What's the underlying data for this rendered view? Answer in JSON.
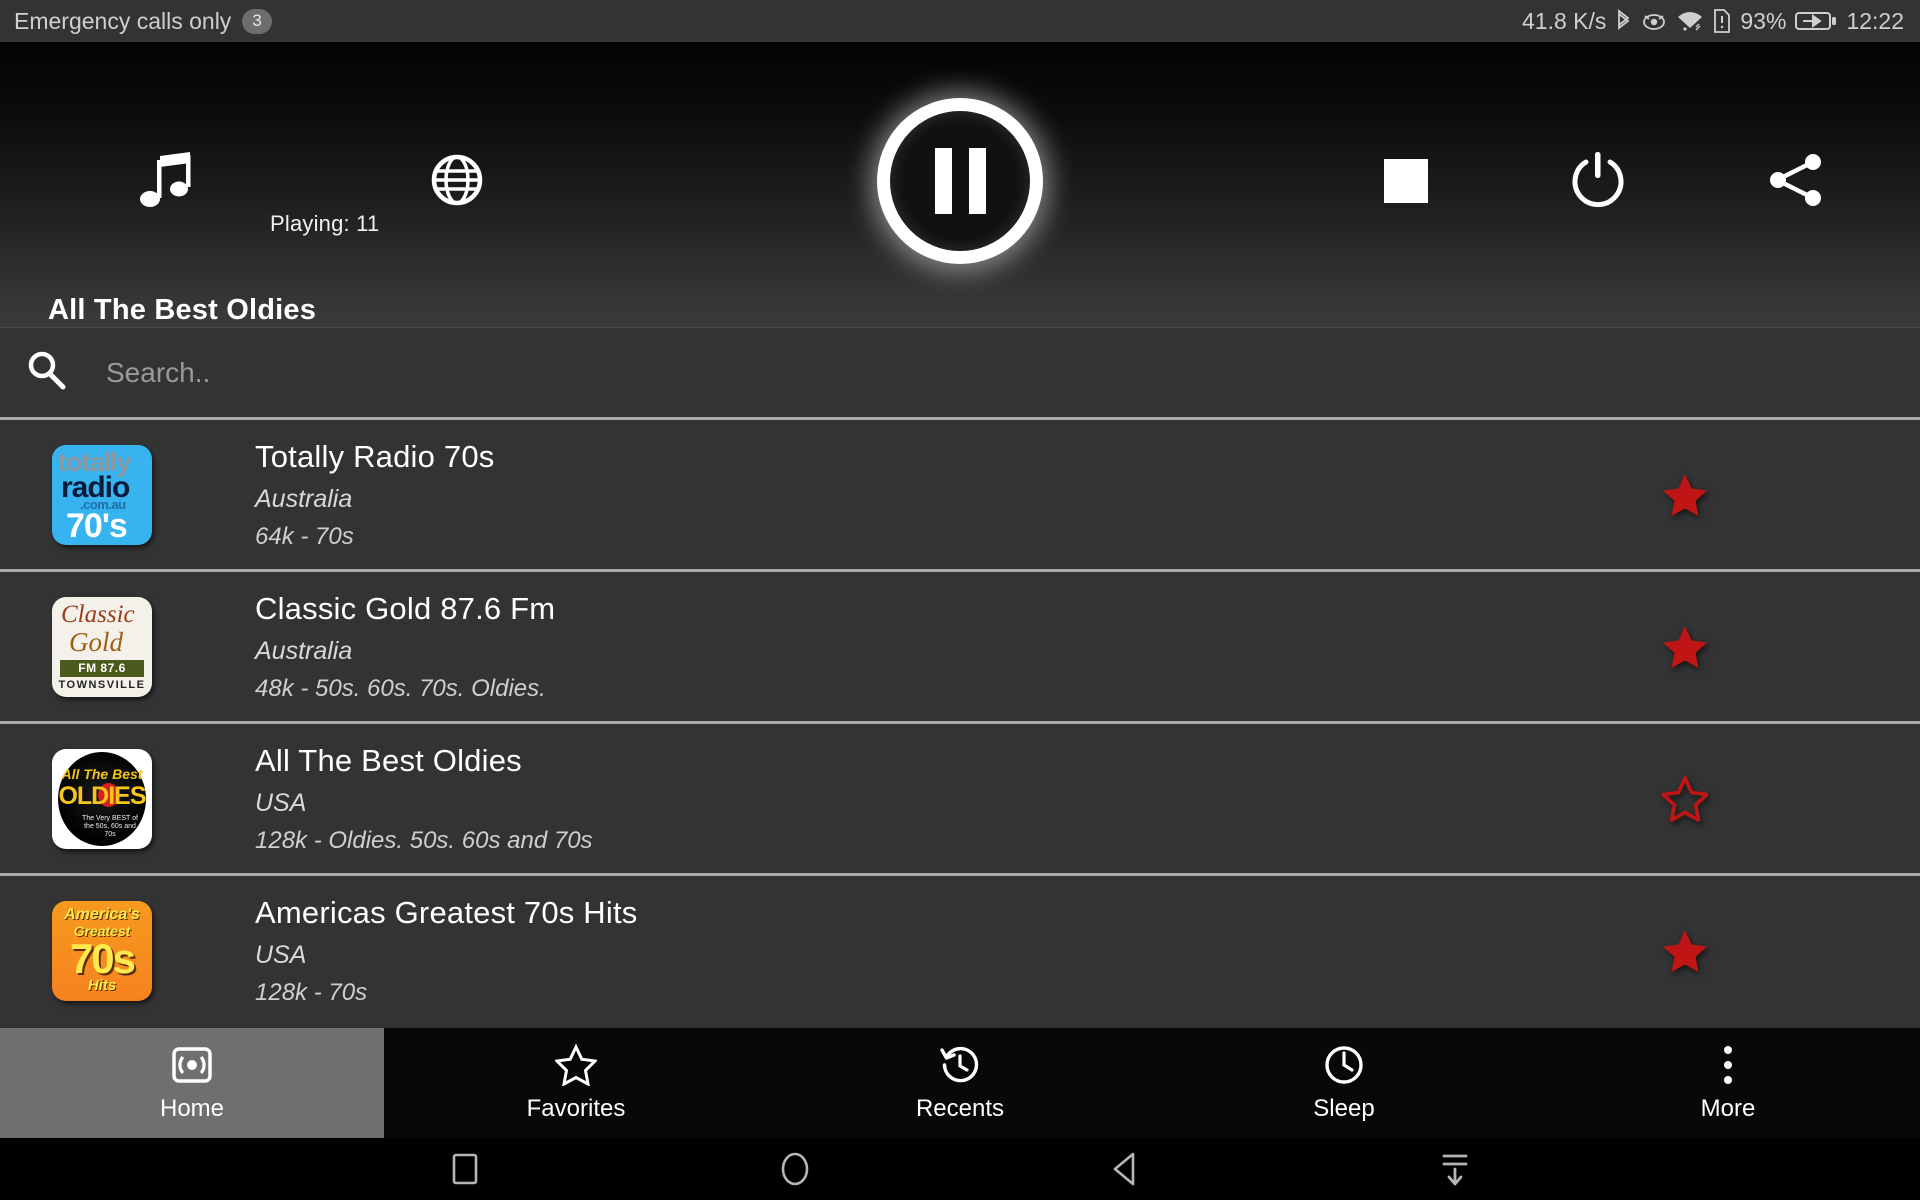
{
  "status_bar": {
    "carrier_text": "Emergency calls only",
    "notification_count": "3",
    "network_speed": "41.8 K/s",
    "battery_percent": "93%",
    "clock": "12:22",
    "icons": [
      "bluetooth-icon",
      "eye-icon",
      "wifi-icon",
      "sim-alert-icon",
      "battery-charging-icon"
    ]
  },
  "player": {
    "playing_label": "Playing: 11",
    "now_playing_station": "All The Best Oldies",
    "controls": {
      "music_label": "music-note-icon",
      "globe_label": "globe-icon",
      "pause_label": "pause-icon",
      "stop_label": "stop-icon",
      "power_label": "power-icon",
      "share_label": "share-icon"
    }
  },
  "search": {
    "placeholder": "Search..",
    "value": ""
  },
  "stations": [
    {
      "name": "Totally Radio 70s",
      "country": "Australia",
      "info": "64k - 70s",
      "favorite": true,
      "logo": {
        "style": "lg-totally",
        "l1": "totally",
        "l2": "radio",
        "l3": ".com.au",
        "l4": "70's"
      }
    },
    {
      "name": "Classic Gold 87.6 Fm",
      "country": "Australia",
      "info": "48k - 50s. 60s. 70s. Oldies.",
      "favorite": true,
      "logo": {
        "style": "lg-gold",
        "l1": "Classic",
        "l2": "Gold",
        "l3": "FM 87.6",
        "l4": "TOWNSVILLE"
      }
    },
    {
      "name": "All The Best Oldies",
      "country": "USA",
      "info": "128k - Oldies. 50s. 60s and 70s",
      "favorite": false,
      "logo": {
        "style": "lg-oldies",
        "l1": "All The Best",
        "l2": "OLDIES",
        "l3": "The Very BEST of the 50s, 60s and 70s"
      }
    },
    {
      "name": "Americas Greatest 70s Hits",
      "country": "USA",
      "info": "128k - 70s",
      "favorite": true,
      "logo": {
        "style": "lg-70s",
        "l1": "America's",
        "l2": "Greatest",
        "l3": "70s",
        "l4": "Hits"
      }
    }
  ],
  "tabs": [
    {
      "label": "Home",
      "icon": "broadcast-icon",
      "active": true
    },
    {
      "label": "Favorites",
      "icon": "star-outline-icon",
      "active": false
    },
    {
      "label": "Recents",
      "icon": "history-icon",
      "active": false
    },
    {
      "label": "Sleep",
      "icon": "clock-icon",
      "active": false
    },
    {
      "label": "More",
      "icon": "overflow-menu-icon",
      "active": false
    }
  ],
  "android_nav": [
    {
      "name": "recents-button"
    },
    {
      "name": "home-button"
    },
    {
      "name": "back-button"
    },
    {
      "name": "hide-navbar-button"
    }
  ],
  "colors": {
    "favorite_star": "#c01515",
    "list_background": "#333333",
    "divider": "#a9a9a9",
    "active_tab": "#6f6f6f"
  }
}
